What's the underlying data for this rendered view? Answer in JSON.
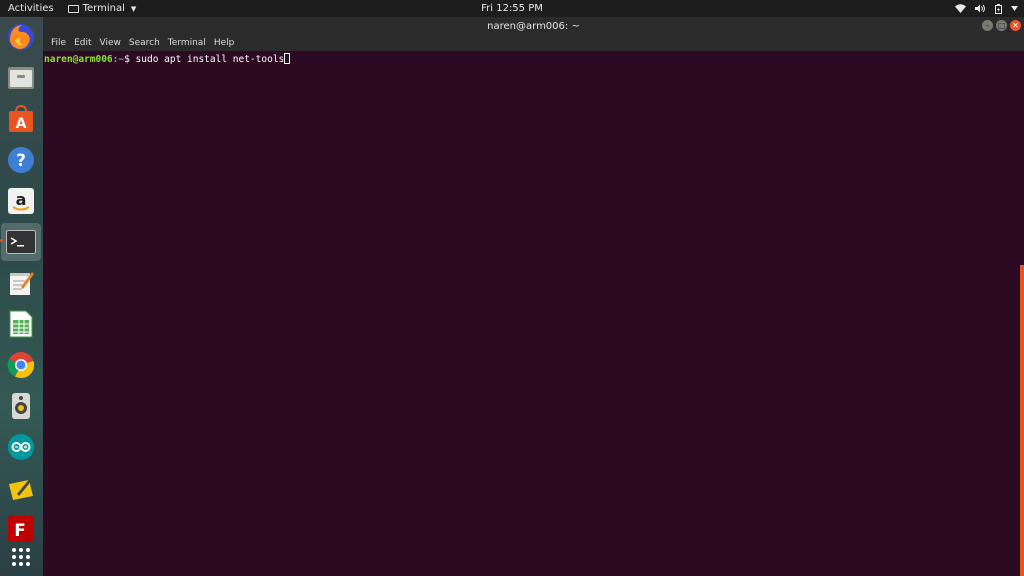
{
  "topbar": {
    "activities": "Activities",
    "app_name": "Terminal",
    "clock": "Fri 12:55 PM"
  },
  "dock": {
    "items": [
      {
        "name": "firefox",
        "icon": "firefox-icon"
      },
      {
        "name": "files",
        "icon": "files-icon"
      },
      {
        "name": "software",
        "icon": "software-center-icon"
      },
      {
        "name": "help",
        "icon": "help-icon"
      },
      {
        "name": "amazon",
        "icon": "amazon-icon"
      },
      {
        "name": "terminal",
        "icon": "terminal-icon"
      },
      {
        "name": "text-editor",
        "icon": "text-editor-icon"
      },
      {
        "name": "calc",
        "icon": "spreadsheet-icon"
      },
      {
        "name": "chrome",
        "icon": "chrome-icon"
      },
      {
        "name": "media",
        "icon": "speaker-icon"
      },
      {
        "name": "arduino",
        "icon": "arduino-icon"
      },
      {
        "name": "notes",
        "icon": "notes-icon"
      },
      {
        "name": "filezilla",
        "icon": "filezilla-icon"
      },
      {
        "name": "app-grid",
        "icon": "app-grid-icon"
      }
    ]
  },
  "window": {
    "title": "naren@arm006: ~",
    "menu": [
      "File",
      "Edit",
      "View",
      "Search",
      "Terminal",
      "Help"
    ]
  },
  "terminal": {
    "user_host": "naren@arm006",
    "path": ":~",
    "symbol": "$ ",
    "command": "sudo apt install net-tools"
  },
  "colors": {
    "terminal_bg": "#2c0a22",
    "prompt_user": "#8ae234",
    "prompt_path": "#729fcf",
    "accent": "#e95420"
  }
}
